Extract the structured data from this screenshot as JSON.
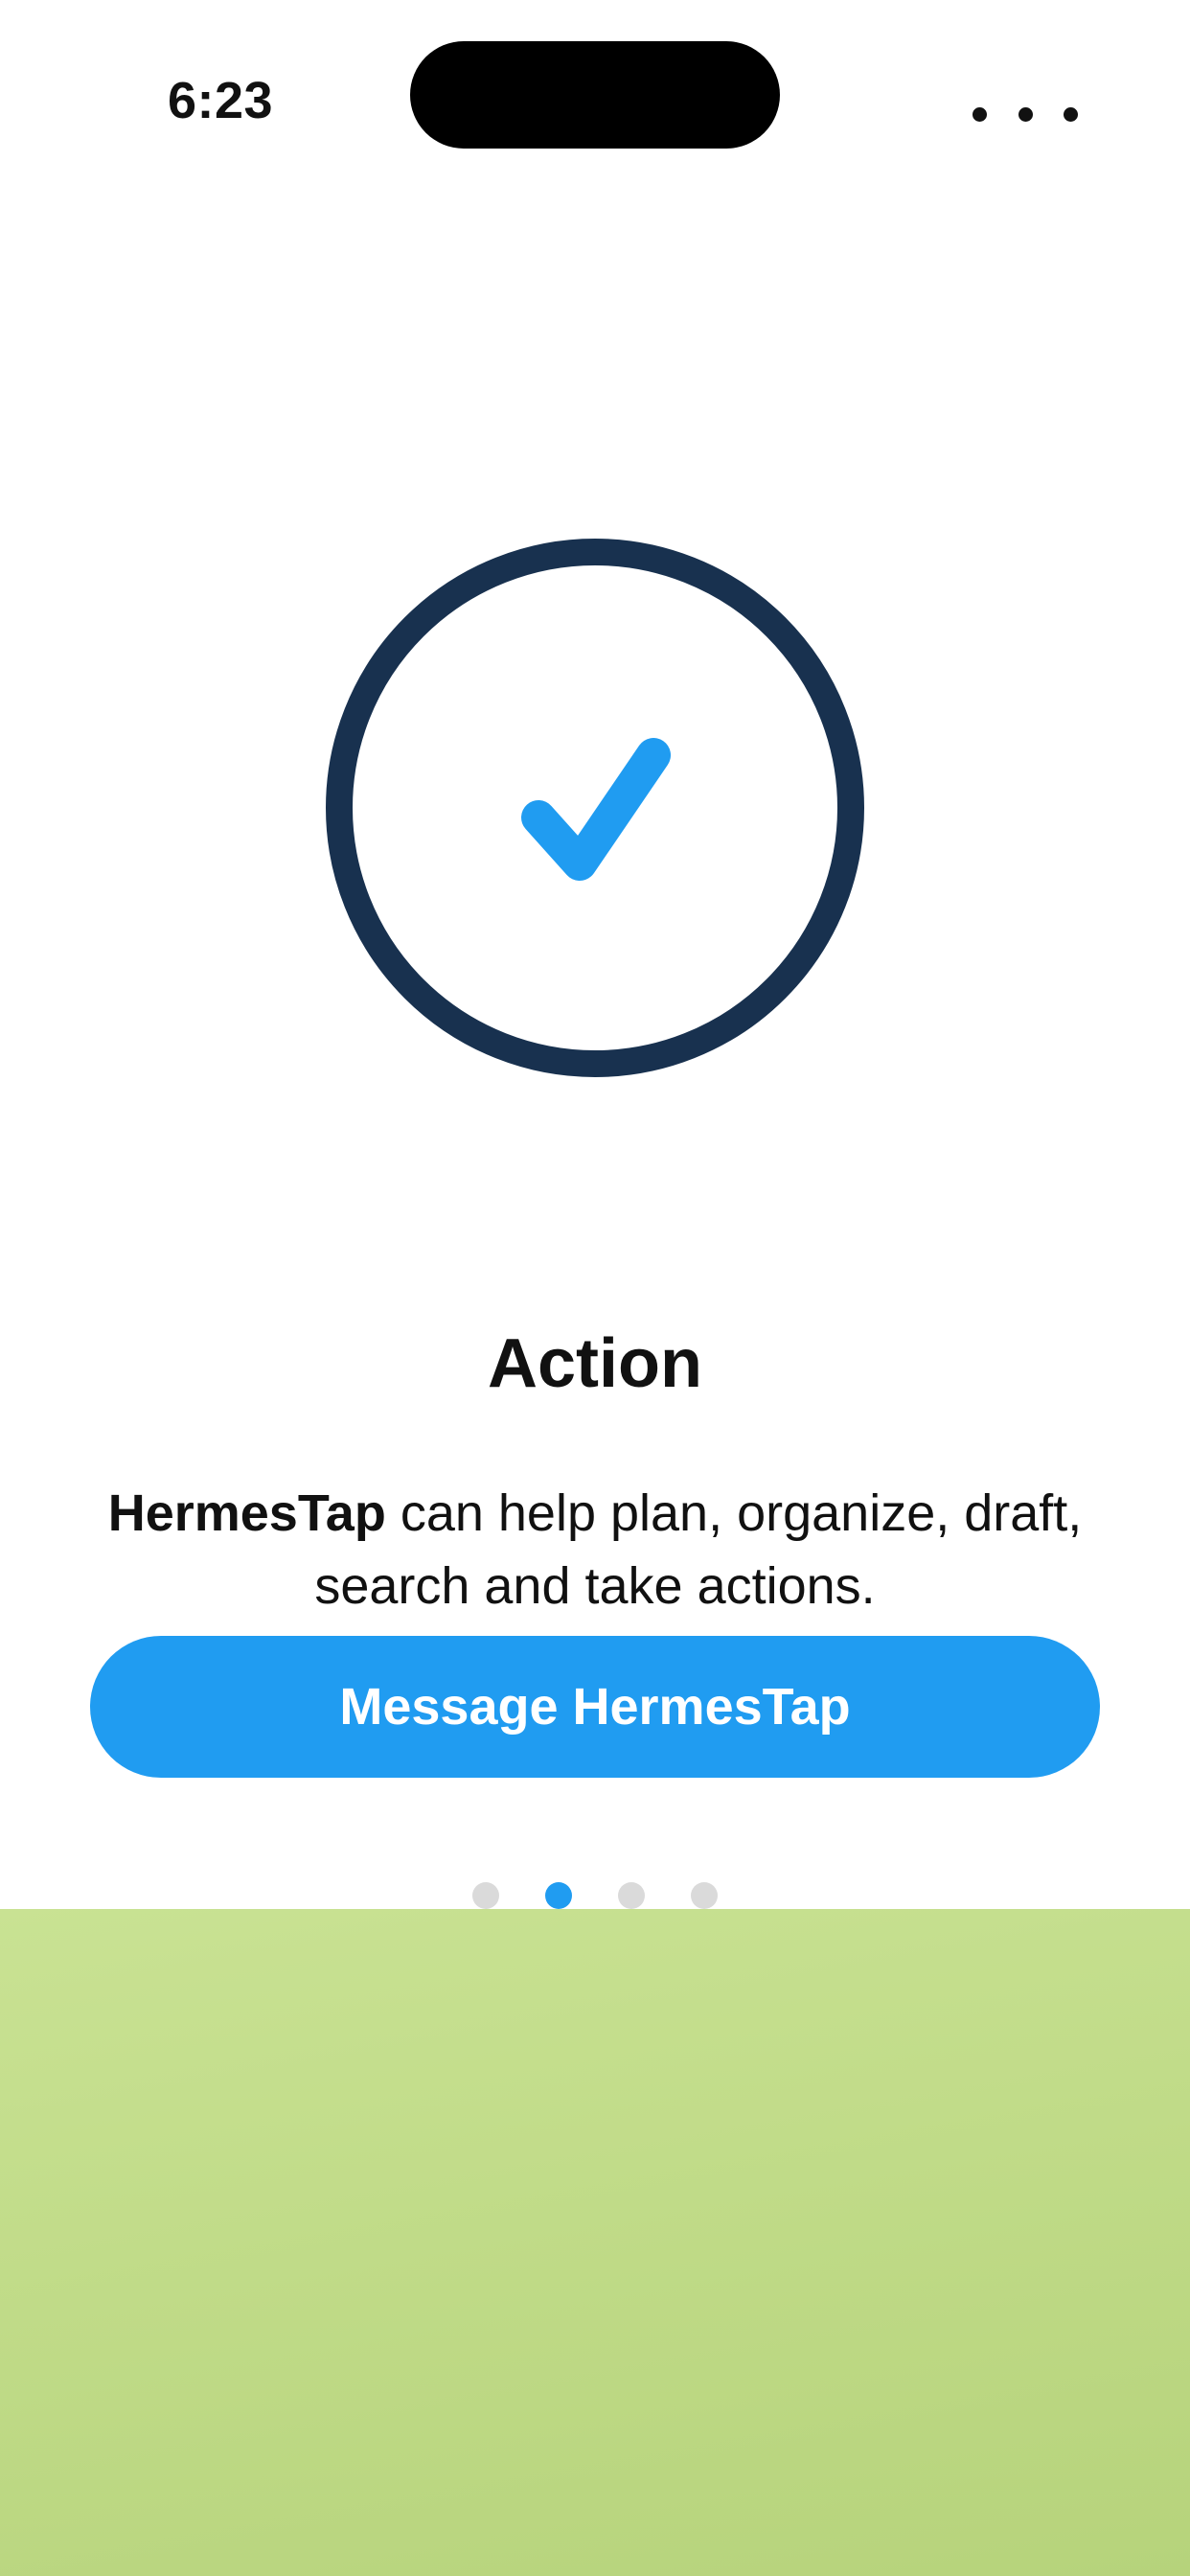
{
  "status_bar": {
    "time": "6:23",
    "menu_icon": "more-horizontal-icon"
  },
  "hero": {
    "icon": "check-circle-icon",
    "ring_color": "#18314f",
    "check_color": "#209cf1"
  },
  "onboarding": {
    "title": "Action",
    "description_brand": "HermesTap",
    "description_rest": " can help plan, organize, draft, search and take actions.",
    "cta_label": "Message HermesTap",
    "pager": {
      "total": 4,
      "active_index": 2
    }
  },
  "colors": {
    "accent": "#209cf1",
    "ring": "#18314f",
    "panel": "#c2dc88",
    "inactive_dot": "#dadada"
  }
}
